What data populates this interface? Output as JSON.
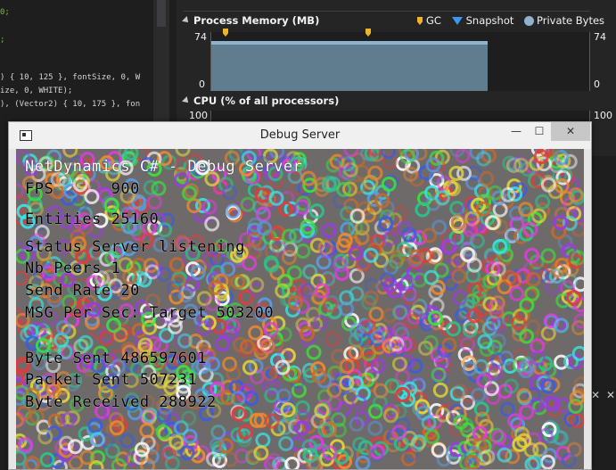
{
  "editor": {
    "lines": [
      {
        "text": "0;",
        "cls": "green"
      },
      {
        "text": ";",
        "cls": "green"
      },
      {
        "text": ") { 10, 125 }, fontSize, 0, W",
        "cls": ""
      },
      {
        "text": "ize, 0, WHITE);",
        "cls": ""
      },
      {
        "text": "), (Vector2) { 10, 175 }, fon",
        "cls": ""
      },
      {
        "text": "",
        "cls": ""
      }
    ]
  },
  "diagnostics": {
    "memory": {
      "title": "Process Memory (MB)",
      "legend": {
        "gc": "GC",
        "snapshot": "Snapshot",
        "private_bytes": "Private Bytes"
      },
      "y_max_left": "74",
      "y_min_left": "0",
      "y_max_right": "74",
      "y_min_right": "0"
    },
    "cpu": {
      "title": "CPU (% of all processors)",
      "y_max_left": "100",
      "y_max_right": "100"
    }
  },
  "window": {
    "title": "Debug Server",
    "minimize": "—",
    "maximize": "☐",
    "close": "✕"
  },
  "stats": {
    "header": "NetDynamics C# - Debug Server",
    "fps": "FPS      900",
    "entities": "Entities 25160",
    "status": "Status Server listening",
    "peers": "Nb Peers 1",
    "send_rate": "Send Rate 20",
    "msg_per_sec": "MSG Per Sec: Target 503200",
    "byte_sent": "Byte Sent 486597601",
    "packet_sent": "Packet Sent 507231",
    "byte_received": "Byte Received 288922"
  },
  "right_strip": {
    "close1": "✕",
    "close2": "✕"
  },
  "colors": {
    "gc": "#f0b429",
    "snapshot": "#3b97f4",
    "private_bytes": "#8fb3cc"
  }
}
